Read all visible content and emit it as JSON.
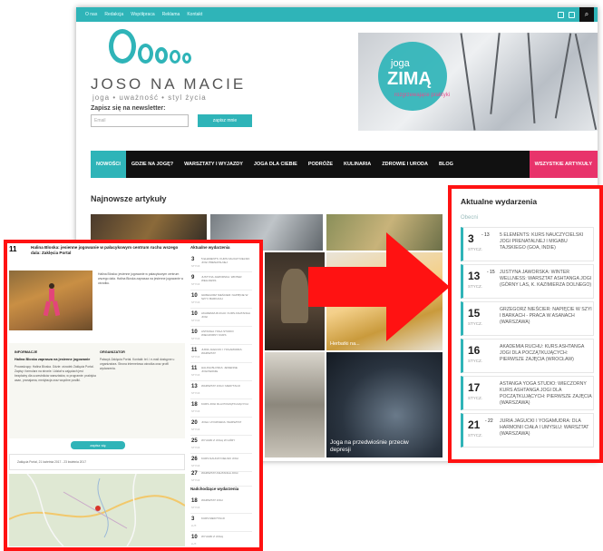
{
  "site": {
    "topbar_links": [
      "O nas",
      "Redakcja",
      "Współpraca",
      "Reklama",
      "Kontakt"
    ],
    "brand": "JOSO NA MACIE",
    "tagline": "joga • uważność • styl życia",
    "newsletter_label": "Zapisz się na newsletter:",
    "newsletter_placeholder": "Email",
    "newsletter_button": "zapisz mnie",
    "banner_small": "joga",
    "banner_big": "ZIMĄ",
    "banner_sub": "rozgrzewające praktyki",
    "nav": [
      "NOWOŚCI",
      "GDZIE NA JOGĘ?",
      "WARSZTATY I WYJAZDY",
      "JOGA DLA CIEBIE",
      "PODRÓŻE",
      "KULINARIA",
      "ZDROWIE I URODA",
      "BLOG",
      "WSZYSTKIE ARTYKUŁY"
    ],
    "latest_heading": "Najnowsze artykuły",
    "thumb_captions": [
      "Herbatki na...",
      "Joga na przedwiośnie przeciw depresji"
    ]
  },
  "events_panel": {
    "title": "Aktualne wydarzenia",
    "subtitle": "Obecni",
    "events": [
      {
        "day": "3",
        "day2": "- 13",
        "month": "STYCZ.",
        "title": "5 ELEMENTS: KURS NAUCZYCIELSKI JOGI PRENATALNEJ I MIGABU TAJSKIEGO (GOA, INDIE)"
      },
      {
        "day": "13",
        "day2": "- 15",
        "month": "STYCZ.",
        "title": "JUSTYNA JAWORSKA: WINTER WELLNESS: WARSZTAT ASHTANGA JOGI (GÓRNY LAS, K. KAZIMIERZA DOLNEGO)"
      },
      {
        "day": "15",
        "day2": "",
        "month": "STYCZ.",
        "title": "GRZEGORZ NIEŚCIER: NAPIĘCIE W SZYI I BARKACH - PRACA W ASANACH (WARSZAWA)"
      },
      {
        "day": "16",
        "day2": "",
        "month": "STYCZ.",
        "title": "AKADEMIA RUCHU: KURS ASHTANGA JOGI DLA POCZĄTKUJĄCYCH: PIERWSZE ZAJĘCIA (WROCŁAW)"
      },
      {
        "day": "17",
        "day2": "",
        "month": "STYCZ.",
        "title": "ASTANGA YOGA STUDIO: WIECZORNY KURS ASHTANGA JOGI DLA POCZĄTKUJĄCYCH: PIERWSZE ZAJĘCIA (WARSZAWA)"
      },
      {
        "day": "21",
        "day2": "- 22",
        "month": "STYCZ.",
        "title": "JURIA JAGUCKI I YOGAMUDRA: DLA HARMONII CIAŁA I UMYSŁU: WARSZTAT (WARSZAWA)"
      }
    ]
  },
  "detail": {
    "day": "11",
    "title": "Halina Bloska: jesienne jogowanie w pałacykowym centrum ruchu wszego dala: Zaklęcia Portal",
    "photo_text": "Halina Bloska: jesienne jogowanie w pałacykowym centrum wszego dala. Halina Bloska zaprasza na jesienne jogowanie w ośrodku.",
    "info_heading": "INFORMACJE",
    "info_title": "Halina Bloska zaprasza na jesienne jogowanie",
    "info_text": "Prowadzący: Halina Bloska. Gdzie: ośrodek Zaklęcia Portal. Zapisy: formularz na stronie. Udział w zajęciach jest bezpłatny dla uczestników warsztatów, w programie: praktyka asan, pranajama, medytacja oraz wspólne posiłki.",
    "org_heading": "ORGANIZATOR",
    "org_text": "Pałacyk Zaklęcia Portal. Kontakt: tel. i e-mail dostępne u organizatora. Strona internetowa ośrodka oraz profil wydarzenia.",
    "signup": "zapisz się",
    "address": "Zaklęcia Portal, 21 kwietnia 2017 - 23 kwietnia 2017",
    "sidebar_title": "Aktualne wydarzenia",
    "sidebar_title2": "Nadchodzące wydarzenia",
    "sidebar_events": [
      {
        "day": "3",
        "month": "STYCZ.",
        "title": "5 ELEMENTS: KURS NAUCZYCIELSKI JOGI PRENATALNEJ"
      },
      {
        "day": "9",
        "month": "STYCZ.",
        "title": "JUSTYNA JAWORSKA: WINTER WELLNESS"
      },
      {
        "day": "10",
        "month": "STYCZ.",
        "title": "GRZEGORZ NIEŚCIER: NAPIĘCIE W SZYI I BARKACH"
      },
      {
        "day": "10",
        "month": "STYCZ.",
        "title": "AKADEMIA RUCHU: KURS ASHTANGA JOGI"
      },
      {
        "day": "10",
        "month": "STYCZ.",
        "title": "ASTANGA YOGA STUDIO: WIECZORNY KURS"
      },
      {
        "day": "11",
        "month": "STYCZ.",
        "title": "JURIA JAGUCKI I YOGAMUDRA: WARSZTAT"
      },
      {
        "day": "11",
        "month": "STYCZ.",
        "title": "HALINA BLOSKA: JESIENNE JOGOWANIE"
      },
      {
        "day": "13",
        "month": "STYCZ.",
        "title": "WARSZTAT JOGI I MEDYTACJI"
      },
      {
        "day": "18",
        "month": "STYCZ.",
        "title": "KURS JOGI DLA POCZĄTKUJĄCYCH"
      },
      {
        "day": "20",
        "month": "STYCZ.",
        "title": "JOGA I AYURVEDA: WARSZTAT"
      },
      {
        "day": "25",
        "month": "STYCZ.",
        "title": "WYJAZD Z JOGĄ W GÓRY"
      },
      {
        "day": "26",
        "month": "STYCZ.",
        "title": "KURS NAUCZYCIELSKI JOGI"
      },
      {
        "day": "27",
        "month": "STYCZ.",
        "title": "WARSZTAT ASHTANGA JOGI"
      }
    ],
    "sidebar_events2": [
      {
        "day": "18",
        "month": "STYCZ.",
        "title": "WARSZTAT JOGI"
      },
      {
        "day": "3",
        "month": "LUT.",
        "title": "KURS MEDYTACJI"
      },
      {
        "day": "10",
        "month": "LUT.",
        "title": "WYJAZD Z JOGĄ"
      }
    ]
  },
  "colors": {
    "accent": "#2fb4b8",
    "highlight": "#ff1212",
    "pink": "#e8336b"
  }
}
